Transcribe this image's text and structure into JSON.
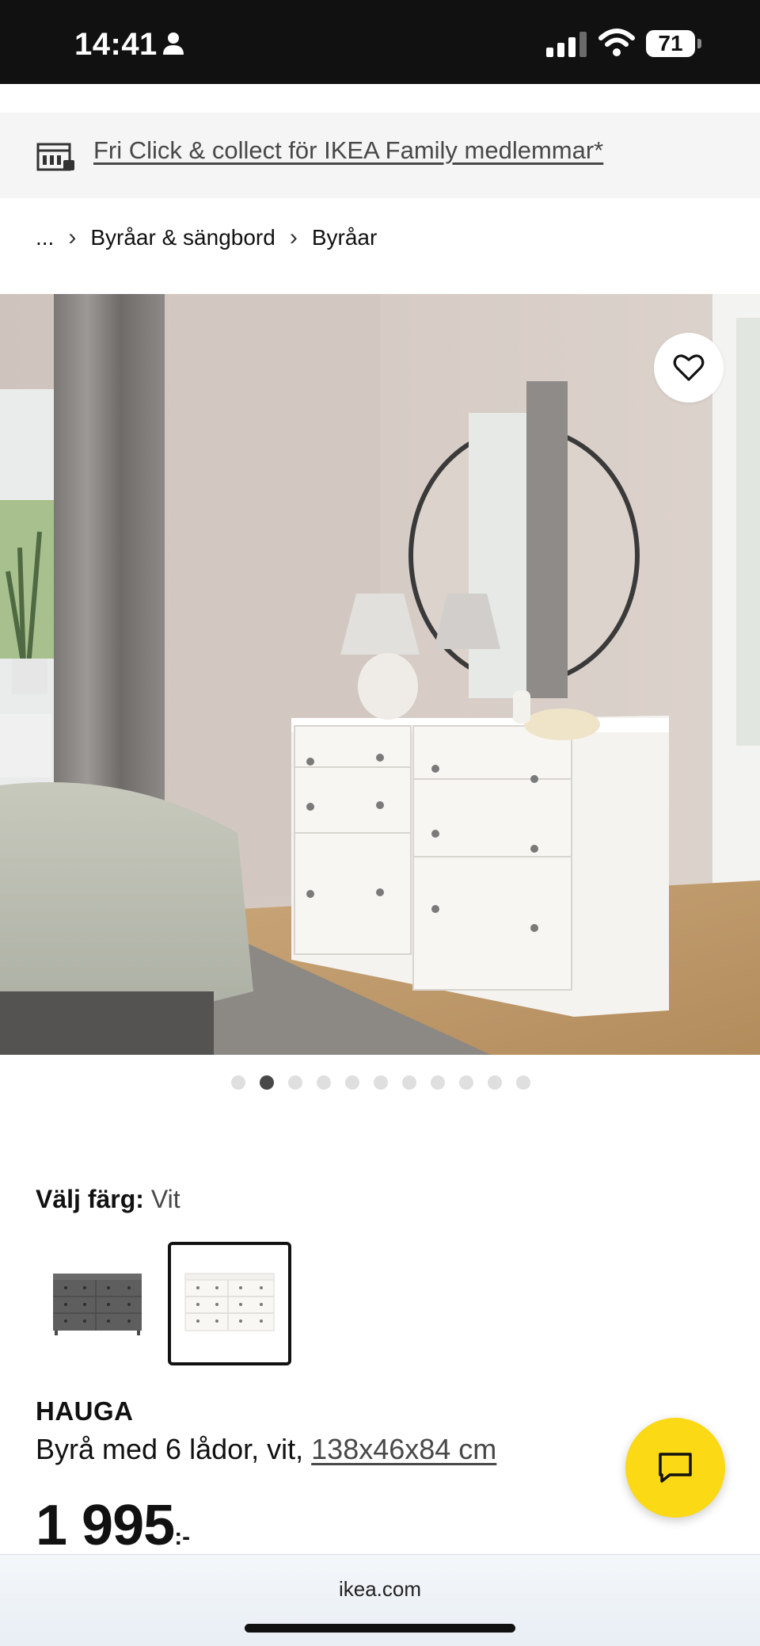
{
  "status_bar": {
    "time": "14:41",
    "battery": "71",
    "icons": [
      "person-icon",
      "cellular-signal-icon",
      "wifi-icon",
      "battery-icon"
    ]
  },
  "promo": {
    "icon": "store-icon",
    "link_text": "Fri Click & collect för IKEA Family medlemmar*"
  },
  "breadcrumb": {
    "ellipsis": "...",
    "items": [
      "Byråar & sängbord",
      "Byråar"
    ]
  },
  "gallery": {
    "favorite_icon": "heart-icon",
    "dot_count": 11,
    "active_index": 1
  },
  "color_choice": {
    "label": "Välj färg:",
    "selected": "Vit",
    "options": [
      "grey",
      "white"
    ]
  },
  "product": {
    "name": "HAUGA",
    "description": "Byrå med 6 lådor, vit, ",
    "measurement": "138x46x84 cm",
    "price": "1 995",
    "price_suffix": ":-"
  },
  "chat": {
    "icon": "chat-bubble-icon"
  },
  "browser": {
    "url": "ikea.com"
  },
  "colors": {
    "accent_yellow": "#fbd914",
    "text": "#111111",
    "muted": "#484848",
    "banner_bg": "#f5f5f5"
  }
}
